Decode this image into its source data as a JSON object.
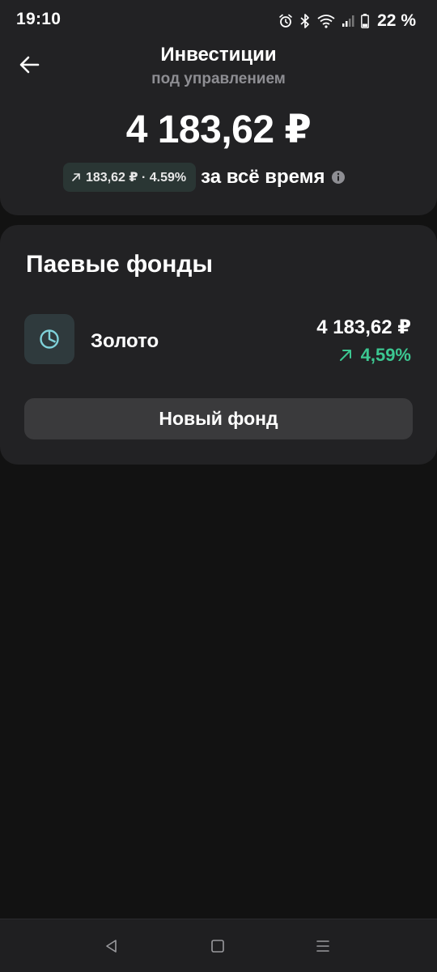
{
  "status_bar": {
    "time": "19:10",
    "battery": "22 %",
    "icons": [
      "alarm-icon",
      "bluetooth-icon",
      "wifi-icon",
      "signal-icon",
      "battery-icon"
    ]
  },
  "header": {
    "title": "Инвестиции",
    "subtitle": "под управлением",
    "total_amount": "4 183,62 ₽",
    "gain_badge": "183,62 ₽ · 4.59%",
    "gain_period": "за всё время"
  },
  "funds": {
    "section_title": "Паевые фонды",
    "items": [
      {
        "name": "Золото",
        "amount": "4 183,62 ₽",
        "return": "4,59%",
        "icon": "pie-chart-icon"
      }
    ],
    "new_fund_label": "Новый фонд"
  },
  "navigation": {
    "buttons": [
      "back-icon",
      "home-icon",
      "recents-icon"
    ]
  },
  "colors": {
    "background": "#121212",
    "card": "#222224",
    "positive": "#3cc791",
    "muted": "#8e8e93",
    "button": "#3a3a3c"
  }
}
